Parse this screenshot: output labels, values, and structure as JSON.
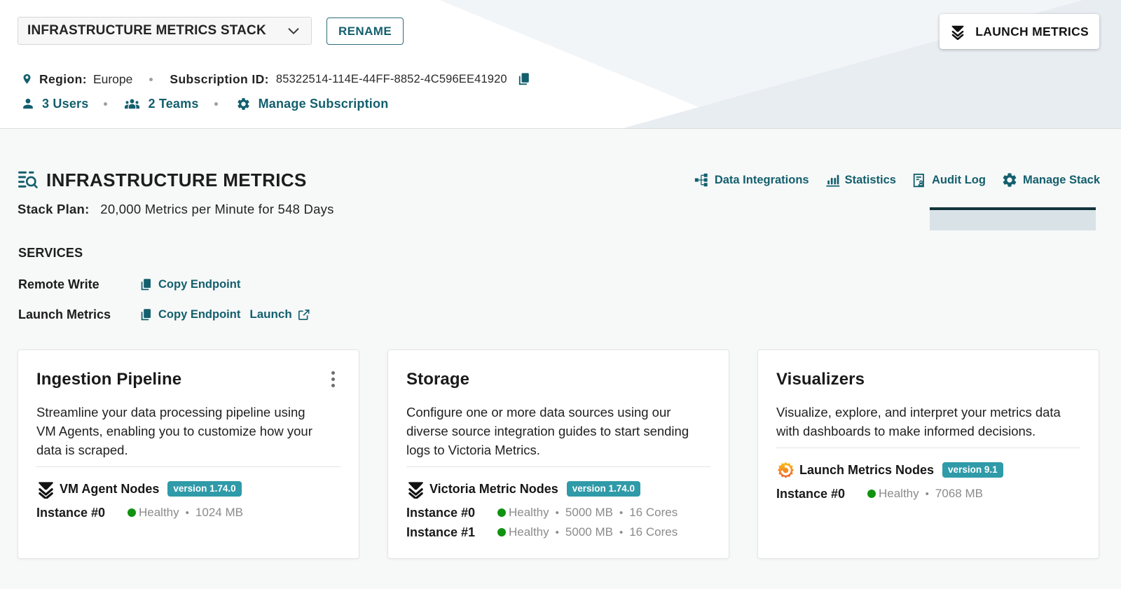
{
  "colors": {
    "accent_teal": "#135f6d",
    "badge_teal": "#2f9aa8",
    "healthy_green": "#0f9210",
    "header_diagonal": "#eaeef3",
    "tab_indicator_dark": "#12343c",
    "tab_indicator_light": "#d9e3e7"
  },
  "header": {
    "stack_selector_value": "INFRASTRUCTURE METRICS STACK",
    "rename_label": "RENAME",
    "launch_metrics_label": "LAUNCH METRICS",
    "region_label": "Region:",
    "region_value": "Europe",
    "subscription_id_label": "Subscription ID:",
    "subscription_id_value": "85322514-114E-44FF-8852-4C596EE41920",
    "users_label": "3 Users",
    "teams_label": "2 Teams",
    "manage_subscription_label": "Manage Subscription"
  },
  "main": {
    "title": "INFRASTRUCTURE METRICS",
    "actions": [
      {
        "label": "Data Integrations"
      },
      {
        "label": "Statistics"
      },
      {
        "label": "Audit Log"
      },
      {
        "label": "Manage Stack"
      }
    ],
    "stack_plan_label": "Stack Plan:",
    "stack_plan_value": "20,000 Metrics per Minute for 548 Days",
    "services_heading": "SERVICES",
    "services": [
      {
        "name": "Remote Write",
        "copy_label": "Copy Endpoint"
      },
      {
        "name": "Launch Metrics",
        "copy_label": "Copy Endpoint",
        "launch_label": "Launch"
      }
    ]
  },
  "cards": [
    {
      "title": "Ingestion Pipeline",
      "description": "Streamline your data processing pipeline using VM Agents, enabling you to customize how your data is scraped.",
      "node_name": "VM Agent Nodes",
      "version_badge": "version 1.74.0",
      "instances": [
        {
          "label": "Instance #0",
          "status": "Healthy",
          "details": [
            "1024 MB"
          ]
        }
      ]
    },
    {
      "title": "Storage",
      "description": "Configure one or more data sources using our diverse source integration guides to start sending logs to Victoria Metrics.",
      "node_name": "Victoria Metric Nodes",
      "version_badge": "version 1.74.0",
      "instances": [
        {
          "label": "Instance #0",
          "status": "Healthy",
          "details": [
            "5000 MB",
            "16 Cores"
          ]
        },
        {
          "label": "Instance #1",
          "status": "Healthy",
          "details": [
            "5000 MB",
            "16 Cores"
          ]
        }
      ]
    },
    {
      "title": "Visualizers",
      "description": "Visualize, explore, and interpret your metrics data with dashboards to make informed decisions.",
      "node_name": "Launch Metrics Nodes",
      "version_badge": "version 9.1",
      "instances": [
        {
          "label": "Instance #0",
          "status": "Healthy",
          "details": [
            "7068 MB"
          ]
        }
      ]
    }
  ]
}
